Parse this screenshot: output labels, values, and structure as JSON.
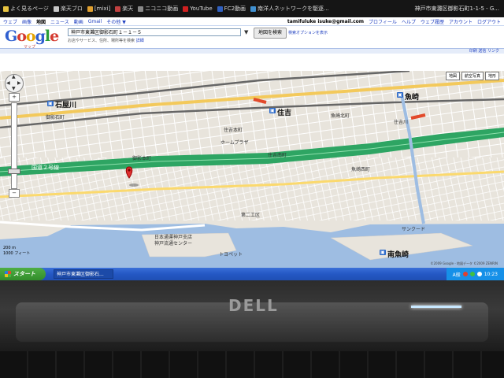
{
  "bookmarks": {
    "items": [
      {
        "label": "よく見るページ",
        "icon": "star-icon",
        "color": "#e8c440"
      },
      {
        "label": "楽天ブロ",
        "icon": "page-icon",
        "color": "#c8c8c8"
      },
      {
        "label": "[mixi]",
        "icon": "mixi-icon",
        "color": "#e0a030"
      },
      {
        "label": "楽天",
        "icon": "page-icon",
        "color": "#c04040"
      },
      {
        "label": "ニコニコ動画",
        "icon": "nico-icon",
        "color": "#888888"
      },
      {
        "label": "YouTube",
        "icon": "youtube-icon",
        "color": "#d02020"
      },
      {
        "label": "FC2動画",
        "icon": "fc2-icon",
        "color": "#3060c0"
      },
      {
        "label": "南洋人ネットワークを駆逐...",
        "icon": "page-icon",
        "color": "#4090d0"
      }
    ],
    "address": "神戸市東灘区御影石町1-1-5 - G..."
  },
  "google_bar": {
    "links": [
      "ウェブ",
      "画像",
      "地図",
      "ニュース",
      "動画",
      "Gmail",
      "その他 ▼"
    ],
    "active_index": 2,
    "user_email": "tamifuluke isuke@gmail.com",
    "right_links": [
      "プロフィール",
      "ヘルプ",
      "ウェブ履歴",
      "アカウント",
      "ログアウト"
    ]
  },
  "header": {
    "logo_letters": [
      "G",
      "o",
      "o",
      "g",
      "l",
      "e"
    ],
    "logo_sub": "マップ",
    "search_value": "神戸市東灘区御影石町１－１－５",
    "search_button": "地図を検索",
    "search_options": "検索オプションを表示",
    "hint_text": "お店やサービス、住所、場所等を検索",
    "hint_link": "詳細"
  },
  "results_link": "印刷 送信 リンク",
  "map": {
    "types": [
      "地図",
      "航空写真",
      "地形"
    ],
    "labels": [
      {
        "text": "石屋川",
        "kind": "big"
      },
      {
        "text": "住吉",
        "kind": "big"
      },
      {
        "text": "魚崎",
        "kind": "big"
      },
      {
        "text": "御影石町",
        "kind": "normal"
      },
      {
        "text": "御影本町",
        "kind": "normal"
      },
      {
        "text": "住吉南町",
        "kind": "normal"
      },
      {
        "text": "魚崎西町",
        "kind": "normal"
      },
      {
        "text": "国道２号線",
        "kind": "road"
      },
      {
        "text": "第二工区",
        "kind": "normal"
      },
      {
        "text": "日本通運神戸支店",
        "kind": "normal"
      },
      {
        "text": "神戸流通センター",
        "kind": "normal"
      },
      {
        "text": "トヨペット",
        "kind": "normal"
      },
      {
        "text": "サンクード",
        "kind": "normal"
      },
      {
        "text": "住吉本町",
        "kind": "normal"
      },
      {
        "text": "魚崎北町",
        "kind": "normal"
      },
      {
        "text": "南魚崎",
        "kind": "big"
      },
      {
        "text": "ホームプラザ",
        "kind": "normal"
      },
      {
        "text": "住吉川",
        "kind": "normal"
      }
    ],
    "scale": "200 m",
    "scale2": "1000 フィート",
    "copyright": "©2009 Google - 地図データ ©2009 ZENRIN"
  },
  "taskbar": {
    "start_label": "スタート",
    "window_button": "神戸市東灘区御影石...",
    "tray_lang": "A般",
    "tray_time": "10:23"
  },
  "laptop": {
    "brand": "DELL"
  }
}
